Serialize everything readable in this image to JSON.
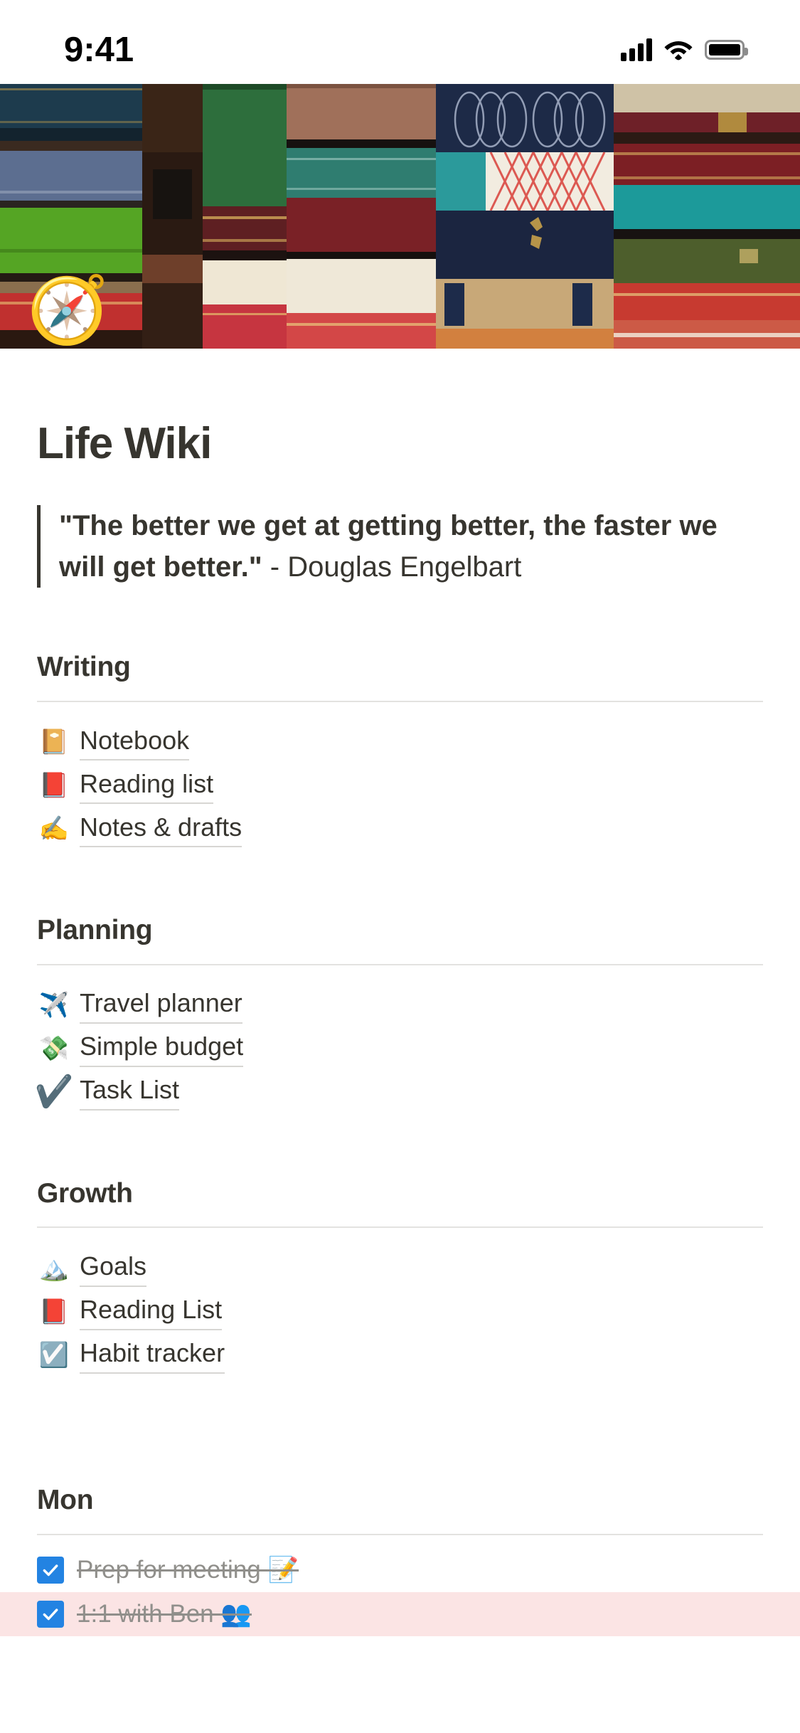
{
  "statusbar": {
    "time": "9:41",
    "signal_icon": "cellular-signal-icon",
    "wifi_icon": "wifi-icon",
    "battery_icon": "battery-full-icon"
  },
  "cover": {
    "alt": "stacked-vintage-books-photo"
  },
  "page": {
    "icon": "🧭",
    "icon_name": "compass-icon",
    "title": "Life Wiki",
    "quote_text": "\"The better we get at getting better, the faster we will get better.\"",
    "quote_attribution": " - Douglas Engelbart"
  },
  "sections": [
    {
      "heading": "Writing",
      "links": [
        {
          "emoji": "📔",
          "icon_name": "notebook-icon",
          "label": "Notebook"
        },
        {
          "emoji": "📕",
          "icon_name": "closed-book-icon",
          "label": "Reading list"
        },
        {
          "emoji": "✍️",
          "icon_name": "writing-hand-icon",
          "label": "Notes & drafts"
        }
      ]
    },
    {
      "heading": "Planning",
      "links": [
        {
          "emoji": "✈️",
          "icon_name": "airplane-icon",
          "label": "Travel planner"
        },
        {
          "emoji": "💸",
          "icon_name": "money-with-wings-icon",
          "label": "Simple budget"
        },
        {
          "emoji": "✔️",
          "icon_name": "check-mark-icon",
          "label": "Task List",
          "glyph": true
        }
      ]
    },
    {
      "heading": "Growth",
      "links": [
        {
          "emoji": "🏔️",
          "icon_name": "snow-capped-mountain-icon",
          "label": "Goals"
        },
        {
          "emoji": "📕",
          "icon_name": "closed-book-icon",
          "label": "Reading List"
        },
        {
          "emoji": "☑️",
          "icon_name": "ballot-box-with-check-icon",
          "label": "Habit tracker"
        }
      ]
    }
  ],
  "todo_section": {
    "heading": "Mon",
    "items": [
      {
        "label": "Prep for meeting ",
        "emoji": "📝",
        "icon_name": "memo-icon",
        "checked": true,
        "highlighted": false
      },
      {
        "label": "1:1 with Ben ",
        "emoji": "👥",
        "icon_name": "busts-in-silhouette-icon",
        "checked": true,
        "highlighted": true
      }
    ]
  },
  "colors": {
    "text": "#37352F",
    "muted_text": "#908F8B",
    "divider": "#E3E2E0",
    "link_underline": "#D7D6D3",
    "checkbox_blue": "#2383E2",
    "highlight_pink": "#FBE4E4"
  }
}
